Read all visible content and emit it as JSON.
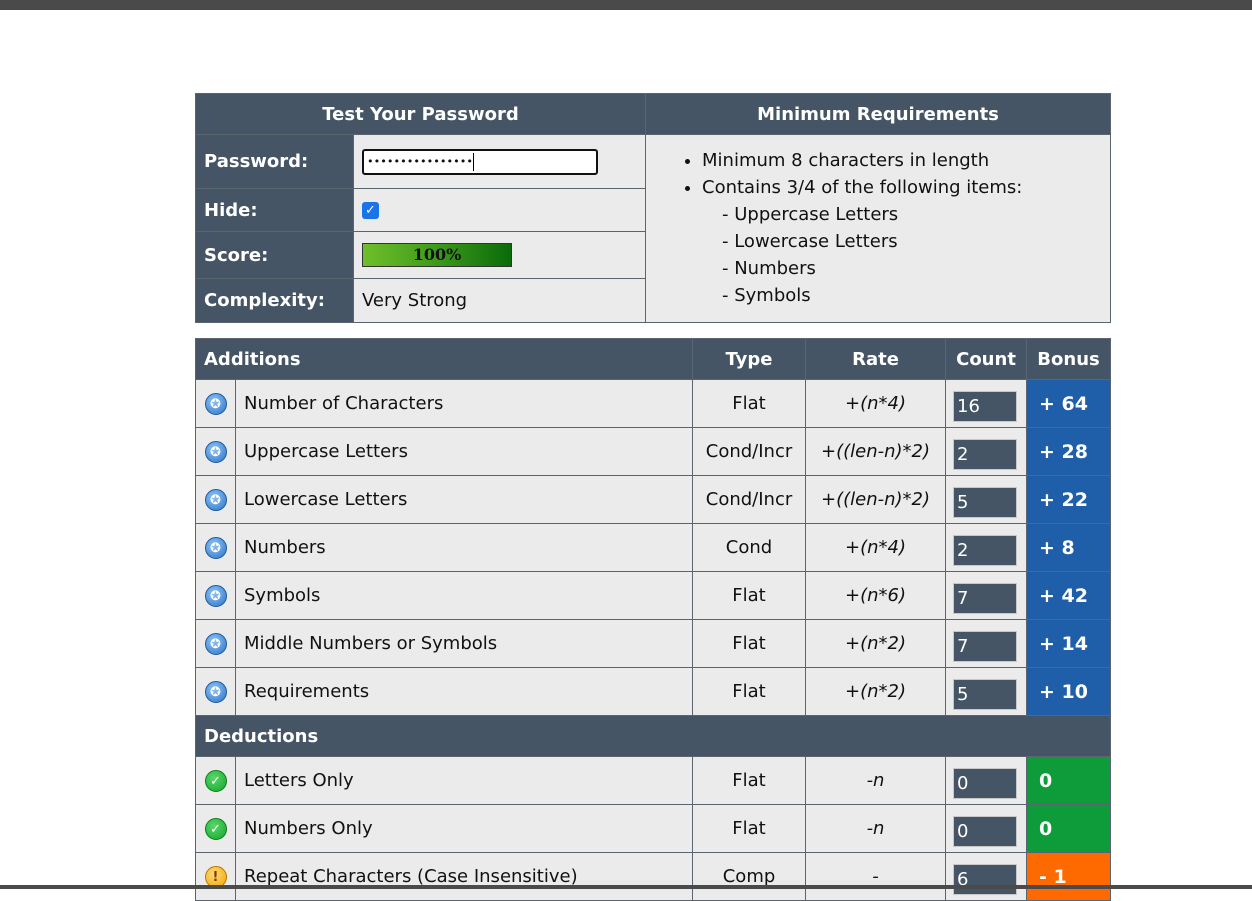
{
  "top": {
    "test_header": "Test Your Password",
    "req_header": "Minimum Requirements",
    "password_label": "Password:",
    "password_value": "••••••••••••••••",
    "hide_label": "Hide:",
    "hide_checked": true,
    "score_label": "Score:",
    "score_text": "100%",
    "score_fraction": 1.0,
    "complexity_label": "Complexity:",
    "complexity_value": "Very Strong",
    "requirements": [
      "Minimum 8 characters in length",
      "Contains 3/4 of the following items:"
    ],
    "sub_requirements": [
      "- Uppercase Letters",
      "- Lowercase Letters",
      "- Numbers",
      "- Symbols"
    ]
  },
  "columns": {
    "additions": "Additions",
    "type": "Type",
    "rate": "Rate",
    "count": "Count",
    "bonus": "Bonus",
    "deductions": "Deductions"
  },
  "additions": [
    {
      "icon": "plus-badge-icon",
      "name": "Number of Characters",
      "type": "Flat",
      "rate": "+(n*4)",
      "count": "16",
      "bonus": "+ 64"
    },
    {
      "icon": "plus-badge-icon",
      "name": "Uppercase Letters",
      "type": "Cond/Incr",
      "rate": "+((len-n)*2)",
      "count": "2",
      "bonus": "+ 28"
    },
    {
      "icon": "plus-badge-icon",
      "name": "Lowercase Letters",
      "type": "Cond/Incr",
      "rate": "+((len-n)*2)",
      "count": "5",
      "bonus": "+ 22"
    },
    {
      "icon": "plus-badge-icon",
      "name": "Numbers",
      "type": "Cond",
      "rate": "+(n*4)",
      "count": "2",
      "bonus": "+ 8"
    },
    {
      "icon": "plus-badge-icon",
      "name": "Symbols",
      "type": "Flat",
      "rate": "+(n*6)",
      "count": "7",
      "bonus": "+ 42"
    },
    {
      "icon": "plus-badge-icon",
      "name": "Middle Numbers or Symbols",
      "type": "Flat",
      "rate": "+(n*2)",
      "count": "7",
      "bonus": "+ 14"
    },
    {
      "icon": "plus-badge-icon",
      "name": "Requirements",
      "type": "Flat",
      "rate": "+(n*2)",
      "count": "5",
      "bonus": "+ 10"
    }
  ],
  "deductions": [
    {
      "icon": "check-icon",
      "name": "Letters Only",
      "type": "Flat",
      "rate": "-n",
      "count": "0",
      "bonus": "0"
    },
    {
      "icon": "check-icon",
      "name": "Numbers Only",
      "type": "Flat",
      "rate": "-n",
      "count": "0",
      "bonus": "0"
    },
    {
      "icon": "warning-icon",
      "name": "Repeat Characters (Case Insensitive)",
      "type": "Comp",
      "rate": "-",
      "count": "6",
      "bonus": "- 1"
    }
  ],
  "colors": {
    "header": "#455565",
    "bonus_blue": "#1f5ea8",
    "bonus_green": "#0e9b3a",
    "bonus_orange": "#ff6a00"
  }
}
